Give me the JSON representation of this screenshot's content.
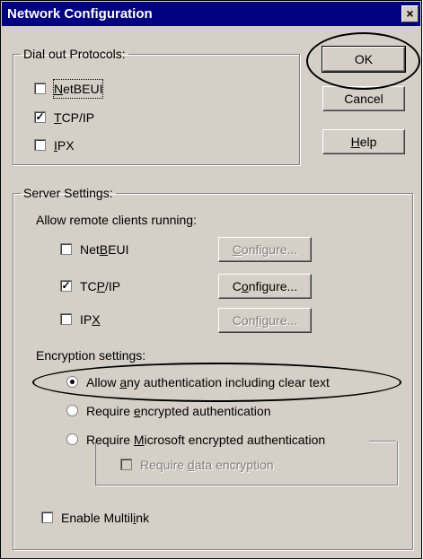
{
  "window": {
    "title": "Network Configuration",
    "close_glyph": "×"
  },
  "dial_out": {
    "legend": "Dial out Protocols:",
    "items": [
      {
        "pre": "",
        "key": "N",
        "post": "etBEUI",
        "checked": false
      },
      {
        "pre": "",
        "key": "T",
        "post": "CP/IP",
        "checked": true
      },
      {
        "pre": "",
        "key": "I",
        "post": "PX",
        "checked": false
      }
    ]
  },
  "buttons": {
    "ok": "OK",
    "cancel": "Cancel",
    "help_key": "H",
    "help_rest": "elp"
  },
  "server": {
    "legend": "Server Settings:",
    "allow_label": "Allow remote clients running:",
    "protocols": [
      {
        "pre": "Net",
        "key": "B",
        "post": "EUI",
        "checked": false,
        "configure_pre": "",
        "configure_key": "C",
        "configure_post": "onfigure...",
        "configure_enabled": false
      },
      {
        "pre": "TC",
        "key": "P",
        "post": "/IP",
        "checked": true,
        "configure_pre": "C",
        "configure_key": "o",
        "configure_post": "nfigure...",
        "configure_enabled": true
      },
      {
        "pre": "IP",
        "key": "X",
        "post": "",
        "checked": false,
        "configure_pre": "Con",
        "configure_key": "f",
        "configure_post": "igure...",
        "configure_enabled": false
      }
    ],
    "encryption_label": "Encryption settings:",
    "encryption": [
      {
        "pre": "Allow ",
        "key": "a",
        "post": "ny authentication including clear text",
        "selected": true
      },
      {
        "pre": "Require ",
        "key": "e",
        "post": "ncrypted authentication",
        "selected": false
      },
      {
        "pre": "Require ",
        "key": "M",
        "post": "icrosoft encrypted authentication",
        "selected": false
      }
    ],
    "require_data_pre": "Require ",
    "require_data_key": "d",
    "require_data_post": "ata encryption",
    "multilink_pre": "Enable Multil",
    "multilink_key": "i",
    "multilink_post": "nk",
    "multilink_checked": false
  },
  "check_glyph": "✓"
}
